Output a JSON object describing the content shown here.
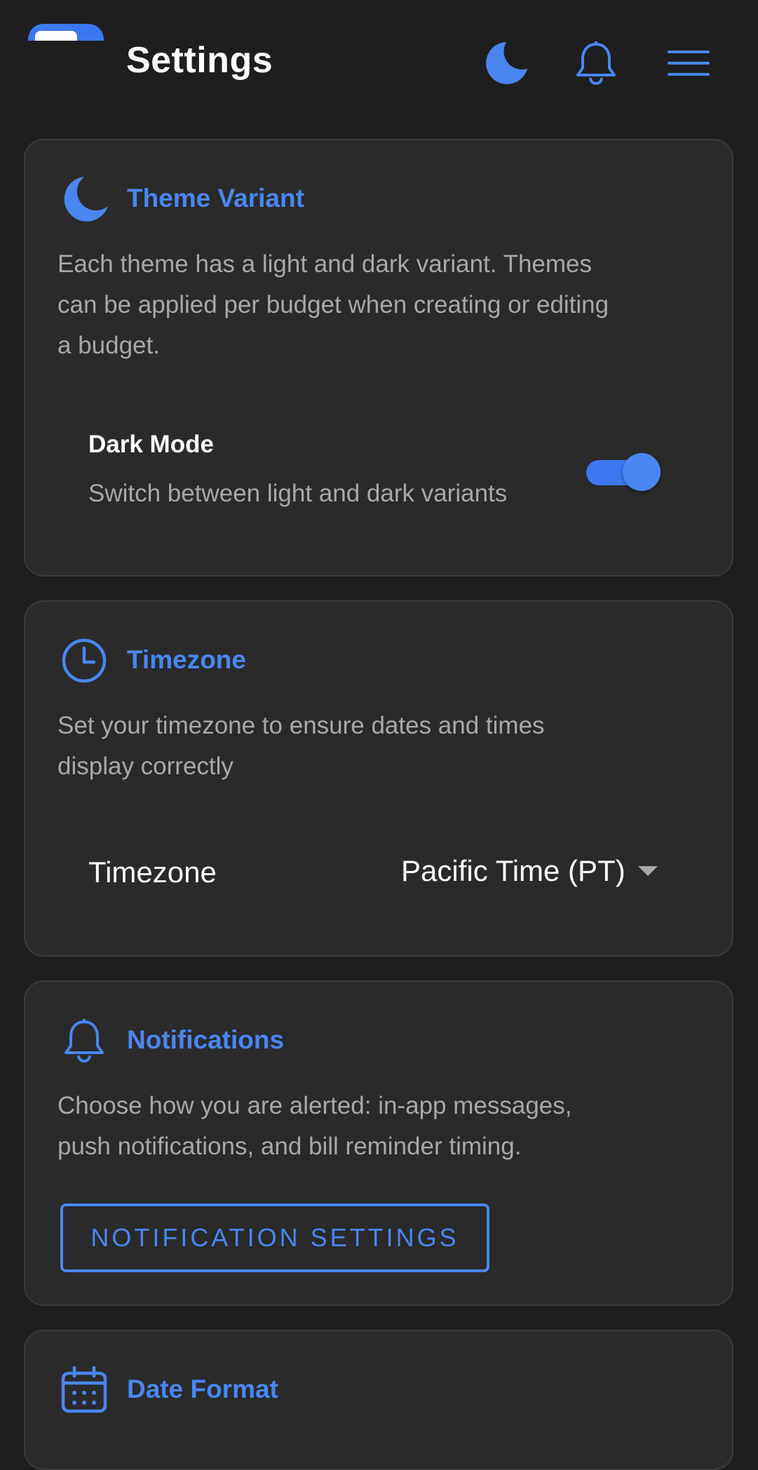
{
  "header": {
    "title": "Settings",
    "icons": [
      "moon-icon",
      "bell-icon",
      "menu-icon"
    ]
  },
  "theme": {
    "title": "Theme Variant",
    "desc_lines": [
      "Each theme has a light and dark variant. Themes",
      "can be applied per budget when creating or editing",
      "a budget."
    ],
    "dark_mode_label": "Dark Mode",
    "dark_mode_sub": "Switch between light and dark variants",
    "dark_mode_on": true
  },
  "timezone": {
    "title": "Timezone",
    "desc_lines": [
      "Set your timezone to ensure dates and times",
      "display correctly"
    ],
    "field_label": "Timezone",
    "selected": "Pacific Time (PT)"
  },
  "notifications": {
    "title": "Notifications",
    "desc_lines": [
      "Choose how you are alerted: in-app messages,",
      "push notifications, and bill reminder timing."
    ],
    "button_label": "NOTIFICATION SETTINGS"
  },
  "date_format": {
    "title": "Date Format"
  },
  "colors": {
    "accent": "#4a86f0",
    "background": "#1e1e1f",
    "card": "#2a2a2b",
    "muted_text": "#a8a8ab"
  }
}
